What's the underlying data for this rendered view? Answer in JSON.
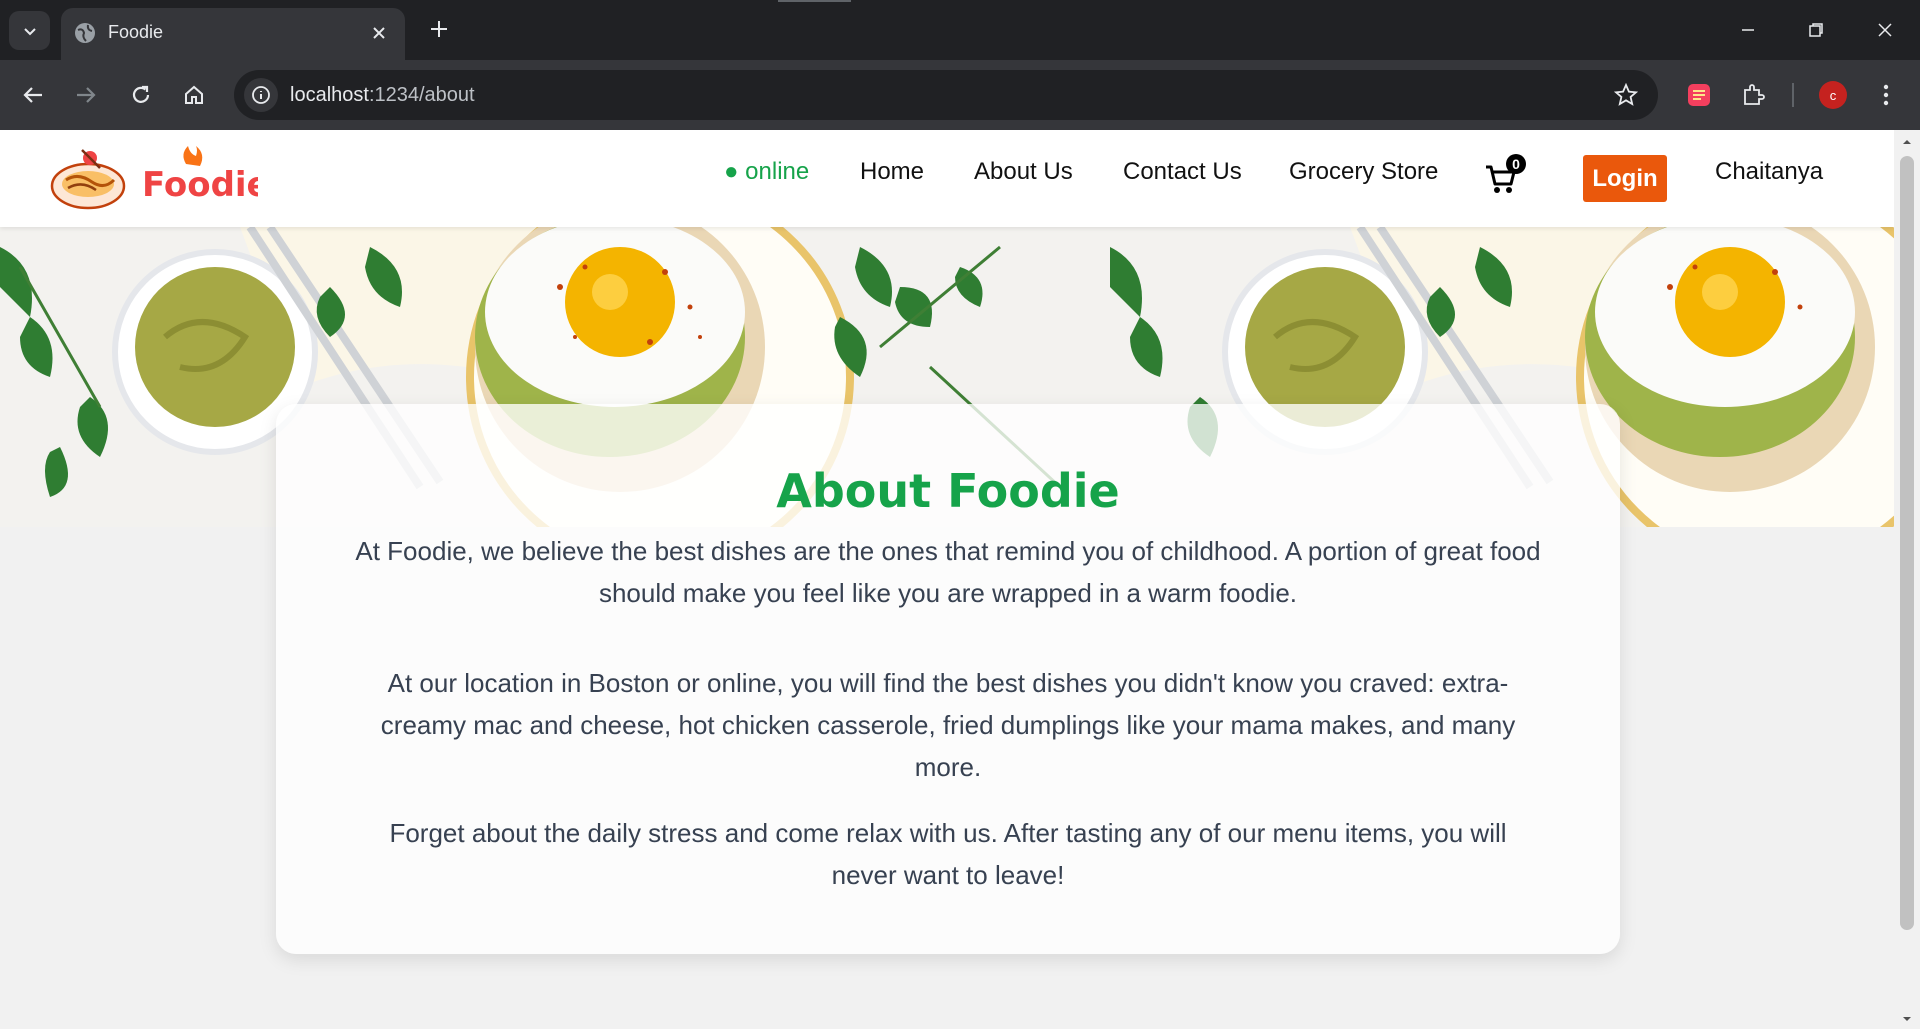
{
  "browser": {
    "tab_title": "Foodie",
    "url_host": "localhost",
    "url_path": ":1234/about",
    "profile_initial": "c"
  },
  "nav": {
    "brand": "Foodie",
    "status": "● online",
    "links": [
      "Home",
      "About Us",
      "Contact Us",
      "Grocery Store"
    ],
    "cart_count": "0",
    "login_label": "Login",
    "user_name": "Chaitanya"
  },
  "about": {
    "title": "About Foodie",
    "paragraph1": "At Foodie, we believe the best dishes are the ones that remind you of childhood. A portion of great food should make you feel like you are wrapped in a warm foodie.",
    "paragraph2": "At our location in Boston or online, you will find the best dishes you didn't know you craved: extra-creamy mac and cheese, hot chicken casserole, fried dumplings like your mama makes, and many more.",
    "paragraph3": "Forget about the daily stress and come relax with us. After tasting any of our menu items, you will never want to leave!"
  },
  "colors": {
    "accent_green": "#16a34a",
    "login_orange": "#ea580c",
    "brand_red": "#ef4444"
  },
  "icons": [
    "tab-search-icon",
    "globe-icon",
    "close-icon",
    "plus-icon",
    "back-icon",
    "forward-icon",
    "reload-icon",
    "home-icon",
    "site-info-icon",
    "star-icon",
    "extension-icon",
    "puzzle-icon",
    "menu-dots-icon",
    "cart-icon"
  ]
}
